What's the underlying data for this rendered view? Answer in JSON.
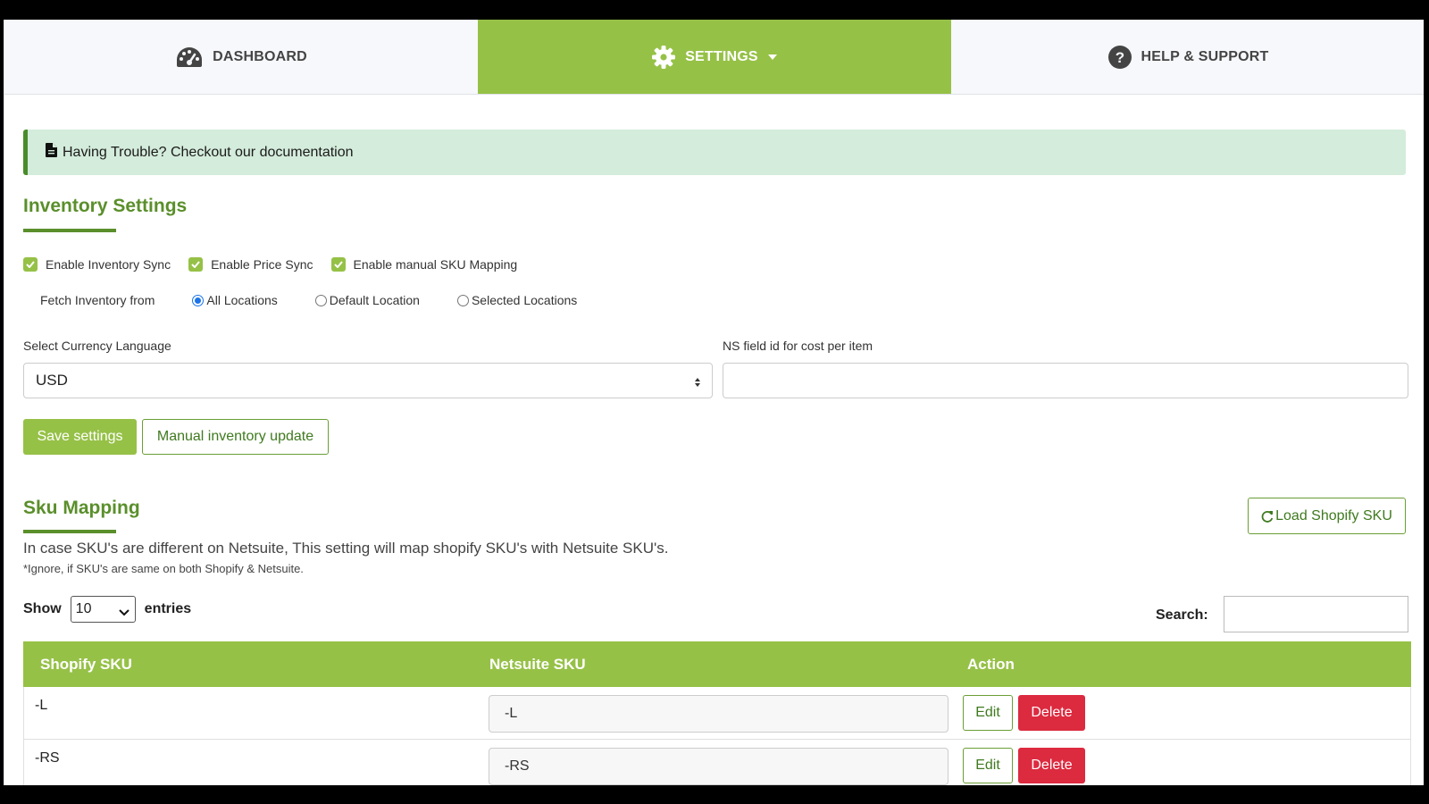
{
  "nav": {
    "tabs": [
      {
        "label": "DASHBOARD",
        "icon": "dashboard-gauge-icon"
      },
      {
        "label": "SETTINGS",
        "icon": "gear-icon",
        "active": true
      },
      {
        "label": "HELP & SUPPORT",
        "icon": "question-circle-icon"
      }
    ]
  },
  "alert": {
    "text": "Having Trouble? Checkout our documentation"
  },
  "inventory": {
    "title": "Inventory Settings",
    "checkboxes": [
      {
        "label": "Enable Inventory Sync",
        "checked": true
      },
      {
        "label": "Enable Price Sync",
        "checked": true
      },
      {
        "label": "Enable manual SKU Mapping",
        "checked": true
      }
    ],
    "fetch_label": "Fetch Inventory from",
    "radios": [
      {
        "label": "All Locations",
        "selected": true
      },
      {
        "label": "Default Location",
        "selected": false
      },
      {
        "label": "Selected Locations",
        "selected": false
      }
    ],
    "currency_label": "Select Currency Language",
    "currency_value": "USD",
    "ns_field_label": "NS field id for cost per item",
    "ns_field_value": "",
    "save_label": "Save settings",
    "manual_update_label": "Manual inventory update"
  },
  "sku_mapping": {
    "title": "Sku Mapping",
    "load_label": "Load Shopify SKU",
    "description": "In case SKU's are different on Netsuite, This setting will map shopify SKU's with Netsuite SKU's.",
    "note": "*Ignore, if SKU's are same on both Shopify & Netsuite.",
    "show_label": "Show",
    "entries_value": "10",
    "entries_label": "entries",
    "search_label": "Search:",
    "columns": [
      "Shopify SKU",
      "Netsuite SKU",
      "Action"
    ],
    "rows": [
      {
        "shopify": "-L",
        "netsuite": "-L"
      },
      {
        "shopify": "-RS",
        "netsuite": "-RS"
      }
    ],
    "edit_label": "Edit",
    "delete_label": "Delete"
  },
  "colors": {
    "brand_green": "#96c147",
    "title_green": "#5a8f2b",
    "delete_red": "#dc2a3f",
    "alert_bg": "#d4ecdb"
  }
}
